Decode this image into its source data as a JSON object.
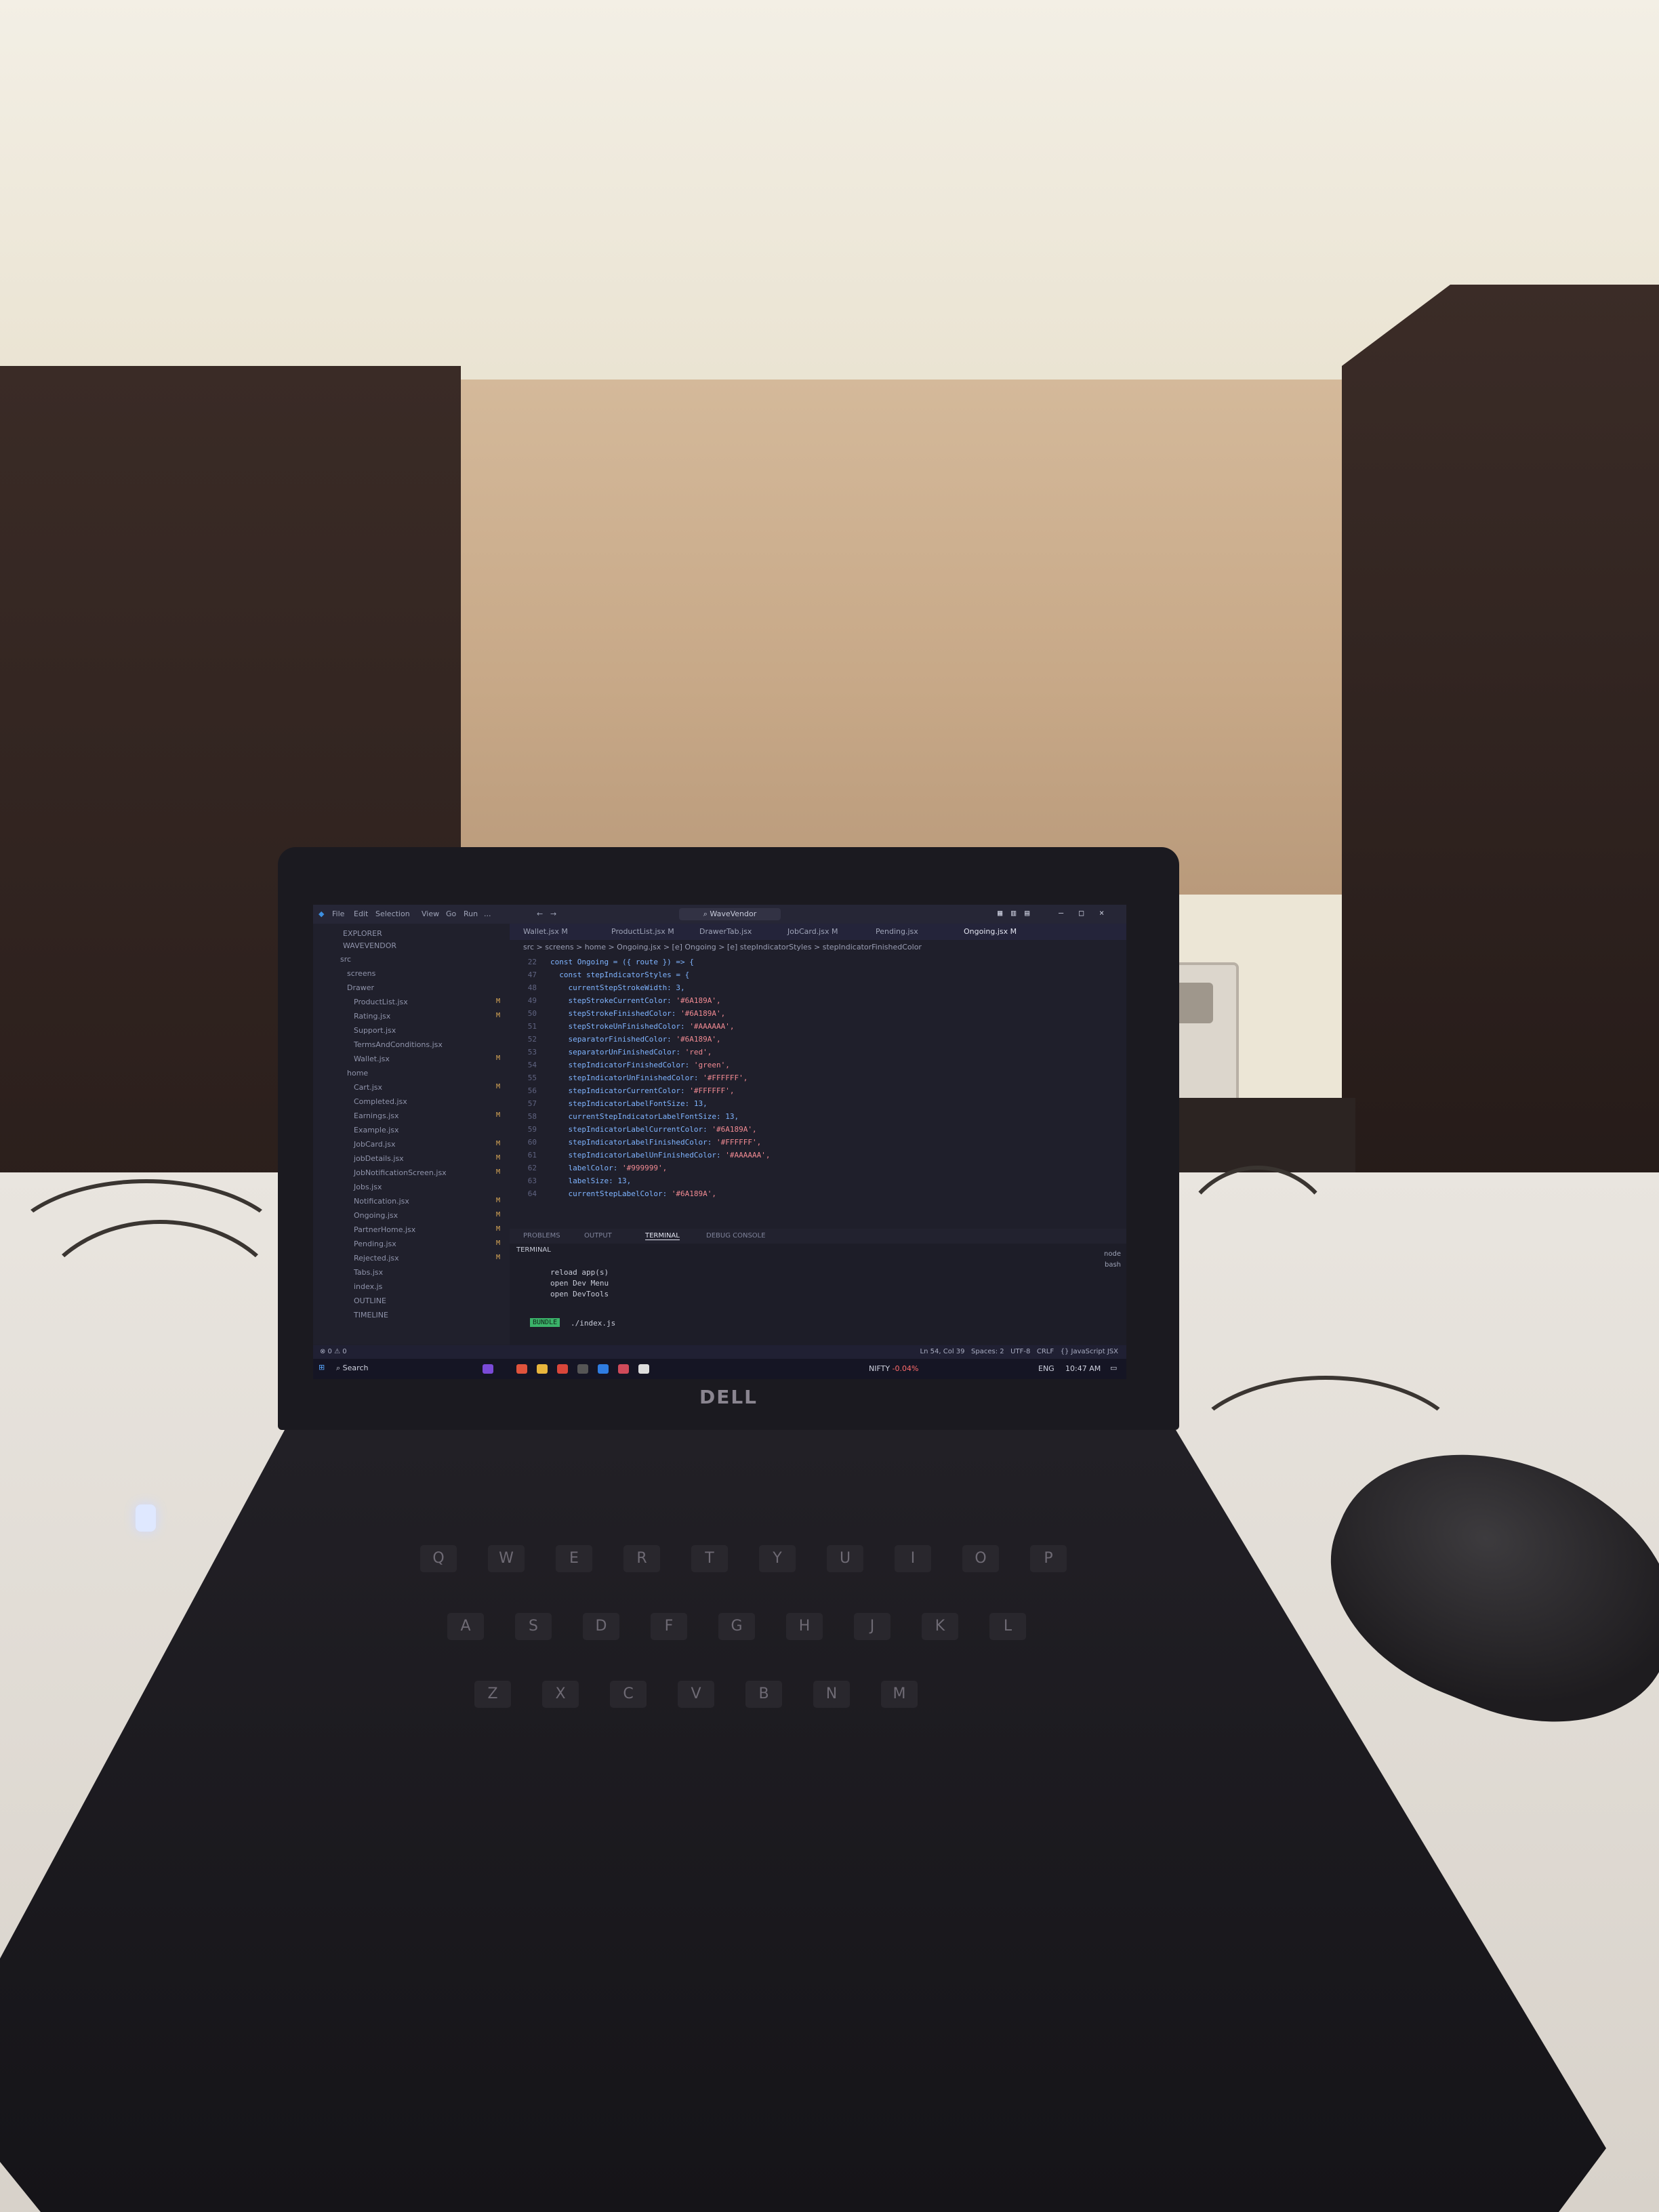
{
  "window": {
    "title": "WaveVendor",
    "menu": [
      "File",
      "Edit",
      "Selection",
      "View",
      "Go",
      "Run",
      "..."
    ]
  },
  "explorer": {
    "header": "EXPLORER",
    "project": "WAVEVENDOR",
    "items": [
      {
        "label": "src",
        "badge": ""
      },
      {
        "label": "screens",
        "badge": ""
      },
      {
        "label": "Drawer",
        "badge": ""
      },
      {
        "label": "ProductList.jsx",
        "badge": "M"
      },
      {
        "label": "Rating.jsx",
        "badge": "M"
      },
      {
        "label": "Support.jsx",
        "badge": ""
      },
      {
        "label": "TermsAndConditions.jsx",
        "badge": ""
      },
      {
        "label": "Wallet.jsx",
        "badge": "M"
      },
      {
        "label": "home",
        "badge": ""
      },
      {
        "label": "Cart.jsx",
        "badge": "M"
      },
      {
        "label": "Completed.jsx",
        "badge": ""
      },
      {
        "label": "Earnings.jsx",
        "badge": "M"
      },
      {
        "label": "Example.jsx",
        "badge": ""
      },
      {
        "label": "JobCard.jsx",
        "badge": "M"
      },
      {
        "label": "jobDetails.jsx",
        "badge": "M"
      },
      {
        "label": "JobNotificationScreen.jsx",
        "badge": "M"
      },
      {
        "label": "Jobs.jsx",
        "badge": ""
      },
      {
        "label": "Notification.jsx",
        "badge": "M"
      },
      {
        "label": "Ongoing.jsx",
        "badge": "M"
      },
      {
        "label": "PartnerHome.jsx",
        "badge": "M"
      },
      {
        "label": "Pending.jsx",
        "badge": "M"
      },
      {
        "label": "Rejected.jsx",
        "badge": "M"
      },
      {
        "label": "Tabs.jsx",
        "badge": ""
      },
      {
        "label": "index.js",
        "badge": ""
      },
      {
        "label": "OUTLINE",
        "badge": ""
      },
      {
        "label": "TIMELINE",
        "badge": ""
      }
    ]
  },
  "tabs": [
    {
      "label": "Wallet.jsx M",
      "active": false
    },
    {
      "label": "ProductList.jsx M",
      "active": false
    },
    {
      "label": "DrawerTab.jsx",
      "active": false
    },
    {
      "label": "JobCard.jsx M",
      "active": false
    },
    {
      "label": "Pending.jsx",
      "active": false
    },
    {
      "label": "Ongoing.jsx M",
      "active": true
    }
  ],
  "breadcrumb": "src > screens > home > Ongoing.jsx > [e] Ongoing > [e] stepIndicatorStyles > stepIndicatorFinishedColor",
  "editor": {
    "lines": [
      {
        "num": "22",
        "code": "const Ongoing = ({ route }) => {",
        "str": ""
      },
      {
        "num": "47",
        "code": "  const stepIndicatorStyles = {",
        "str": ""
      },
      {
        "num": "48",
        "code": "    currentStepStrokeWidth: 3,",
        "str": ""
      },
      {
        "num": "49",
        "code": "    stepStrokeCurrentColor: ",
        "str": "'#6A189A',"
      },
      {
        "num": "50",
        "code": "    stepStrokeFinishedColor: ",
        "str": "'#6A189A',"
      },
      {
        "num": "51",
        "code": "    stepStrokeUnFinishedColor: ",
        "str": "'#AAAAAA',"
      },
      {
        "num": "52",
        "code": "    separatorFinishedColor: ",
        "str": "'#6A189A',"
      },
      {
        "num": "53",
        "code": "    separatorUnFinishedColor: ",
        "str": "'red',"
      },
      {
        "num": "54",
        "code": "    stepIndicatorFinishedColor: ",
        "str": "'green',"
      },
      {
        "num": "55",
        "code": "    stepIndicatorUnFinishedColor: ",
        "str": "'#FFFFFF',"
      },
      {
        "num": "56",
        "code": "    stepIndicatorCurrentColor: ",
        "str": "'#FFFFFF',"
      },
      {
        "num": "57",
        "code": "    stepIndicatorLabelFontSize: 13,",
        "str": ""
      },
      {
        "num": "58",
        "code": "    currentStepIndicatorLabelFontSize: 13,",
        "str": ""
      },
      {
        "num": "59",
        "code": "    stepIndicatorLabelCurrentColor: ",
        "str": "'#6A189A',"
      },
      {
        "num": "60",
        "code": "    stepIndicatorLabelFinishedColor: ",
        "str": "'#FFFFFF',"
      },
      {
        "num": "61",
        "code": "    stepIndicatorLabelUnFinishedColor: ",
        "str": "'#AAAAAA',"
      },
      {
        "num": "62",
        "code": "    labelColor: ",
        "str": "'#999999',"
      },
      {
        "num": "63",
        "code": "    labelSize: 13,",
        "str": ""
      },
      {
        "num": "64",
        "code": "    currentStepLabelColor: ",
        "str": "'#6A189A',"
      }
    ]
  },
  "panel": {
    "tabs": [
      "PROBLEMS",
      "OUTPUT",
      "TERMINAL",
      "DEBUG CONSOLE"
    ],
    "active_tab": "TERMINAL",
    "section": "TERMINAL",
    "lines": [
      "reload app(s)",
      "open Dev Menu",
      "open DevTools"
    ],
    "badge": "BUNDLE",
    "prompt": "./index.js",
    "shells": [
      "node",
      "bash"
    ]
  },
  "statusbar": {
    "left": "⊗ 0 ⚠ 0",
    "right": "Ln 54, Col 39   Spaces: 2   UTF-8   CRLF   {} JavaScript JSX"
  },
  "taskbar": {
    "search": "Search",
    "ticker": "NIFTY",
    "ticker_change": "-0.04%",
    "lang": "ENG",
    "time": "10:47 AM"
  },
  "laptop": {
    "brand": "DELL"
  },
  "keyboard": {
    "row1": [
      "Q",
      "W",
      "E",
      "R",
      "T",
      "Y",
      "U",
      "I",
      "O",
      "P"
    ],
    "row2": [
      "A",
      "S",
      "D",
      "F",
      "G",
      "H",
      "J",
      "K",
      "L"
    ],
    "row3": [
      "Z",
      "X",
      "C",
      "V",
      "B",
      "N",
      "M"
    ]
  },
  "colors": {
    "editor_bg": "#1f1f2b",
    "keyword": "#7fb4ff",
    "string": "#f08a92",
    "terminal_badge": "#3bb36a"
  }
}
